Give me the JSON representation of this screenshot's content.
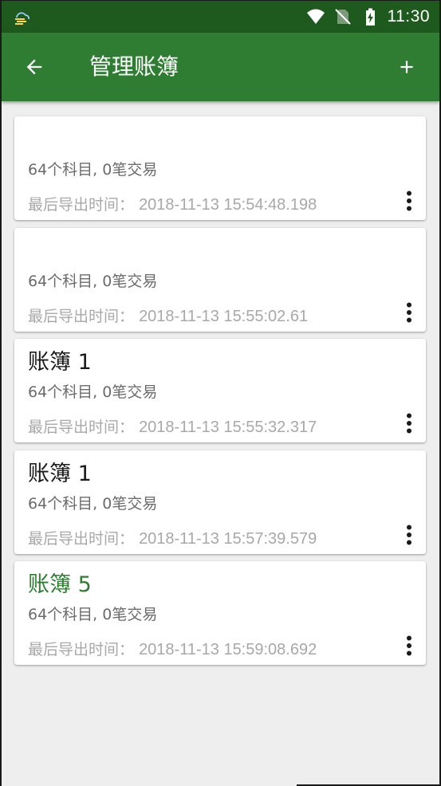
{
  "status_bar": {
    "time": "11:30",
    "icons": [
      "weather-icon",
      "wifi-icon",
      "no-sim-icon",
      "battery-charging-icon"
    ]
  },
  "app_bar": {
    "title": "管理账簿",
    "back_icon": "arrow-back-icon",
    "add_icon": "plus-icon"
  },
  "books": [
    {
      "name": "",
      "summary": "64个科目, 0笔交易",
      "export_label": "最后导出时间：",
      "export_time": "2018-11-13 15:54:48.198",
      "active": false
    },
    {
      "name": "",
      "summary": "64个科目, 0笔交易",
      "export_label": "最后导出时间：",
      "export_time": "2018-11-13 15:55:02.61",
      "active": false
    },
    {
      "name": "账簿 1",
      "summary": "64个科目, 0笔交易",
      "export_label": "最后导出时间：",
      "export_time": "2018-11-13 15:55:32.317",
      "active": false
    },
    {
      "name": "账簿 1",
      "summary": "64个科目, 0笔交易",
      "export_label": "最后导出时间：",
      "export_time": "2018-11-13 15:57:39.579",
      "active": false
    },
    {
      "name": "账簿 5",
      "summary": "64个科目, 0笔交易",
      "export_label": "最后导出时间：",
      "export_time": "2018-11-13 15:59:08.692",
      "active": true
    }
  ],
  "colors": {
    "status_bar": "#1e5a1e",
    "app_bar": "#2e7d32",
    "active_book": "#2e7d32",
    "background": "#eeeeee"
  }
}
